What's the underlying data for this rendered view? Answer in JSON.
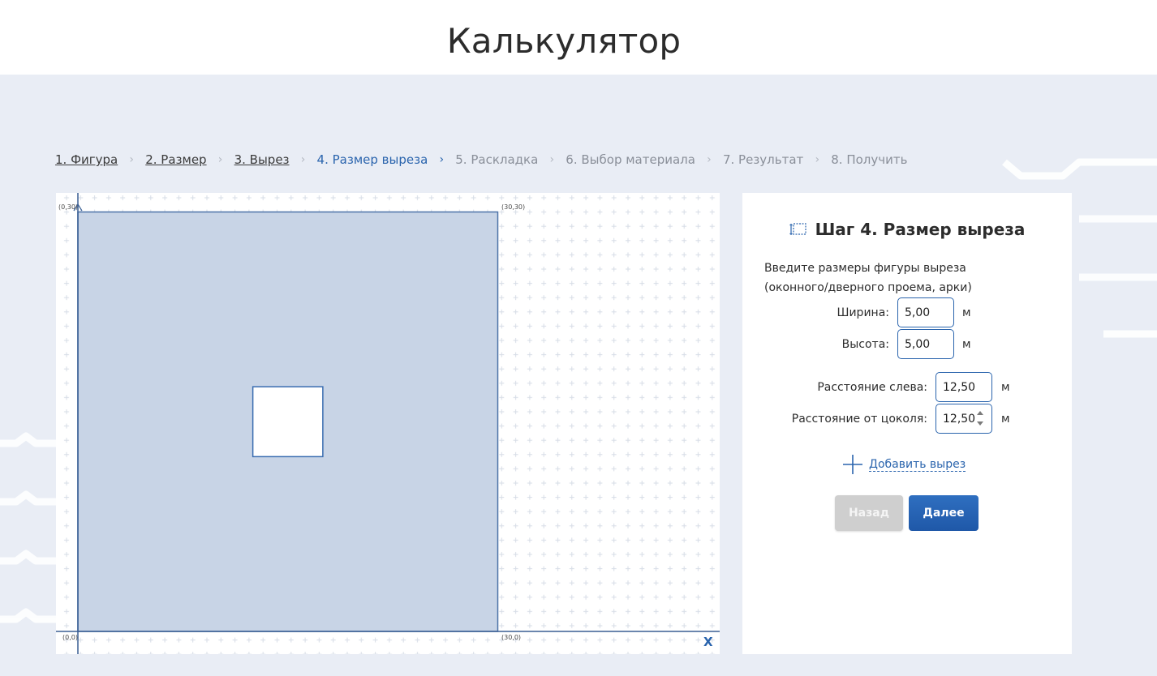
{
  "page": {
    "title": "Калькулятор"
  },
  "steps": [
    {
      "label": "1. Фигура",
      "state": "done"
    },
    {
      "label": "2. Размер",
      "state": "done"
    },
    {
      "label": "3. Вырез",
      "state": "done"
    },
    {
      "label": "4. Размер выреза",
      "state": "active"
    },
    {
      "label": "5. Раскладка",
      "state": "pending"
    },
    {
      "label": "6. Выбор материала",
      "state": "pending"
    },
    {
      "label": "7. Результат",
      "state": "pending"
    },
    {
      "label": "8. Получить",
      "state": "pending"
    }
  ],
  "canvas": {
    "coord_top_left": "(0,30)",
    "coord_top_right": "(30,30)",
    "coord_bottom_left": "(0,0)",
    "coord_bottom_right": "(30,0)",
    "axis_x_label": "X",
    "wall": {
      "width": 30,
      "height": 30
    },
    "cut": {
      "width": 5,
      "height": 5,
      "left": 12.5,
      "bottom": 12.5
    }
  },
  "form": {
    "title": "Шаг 4. Размер выреза",
    "icon": "selection-icon",
    "description": "Введите размеры фигуры выреза (оконного/дверного проема, арки)",
    "width_label": "Ширина:",
    "width_value": "5,00",
    "height_label": "Высота:",
    "height_value": "5,00",
    "left_label": "Расстояние слева:",
    "left_value": "12,50",
    "bottom_label": "Расстояние от цоколя:",
    "bottom_value": "12,50",
    "unit": "м",
    "add_cut_label": "Добавить вырез",
    "back_label": "Назад",
    "next_label": "Далее"
  },
  "colors": {
    "accent": "#2a64ad",
    "wall_fill": "#c8d4e6",
    "background": "#e9edf5",
    "back_button": "#cfcfcf"
  }
}
